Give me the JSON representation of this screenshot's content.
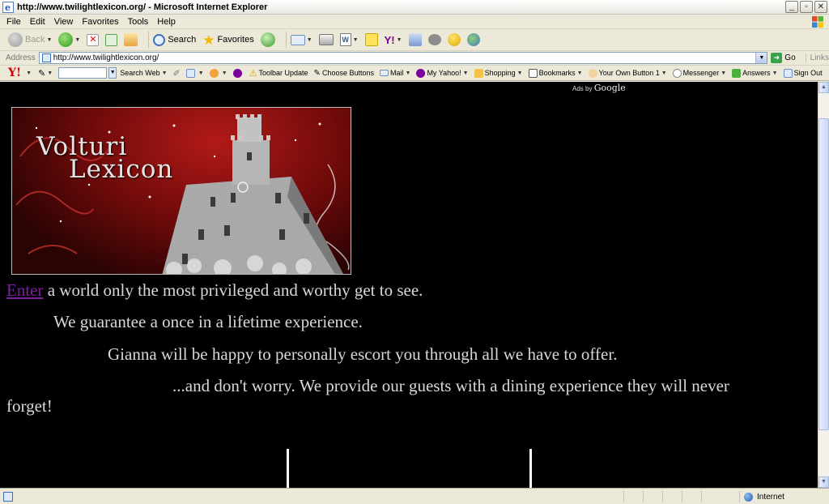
{
  "window": {
    "title": "http://www.twilightlexicon.org/ - Microsoft Internet Explorer",
    "minimize": "_",
    "maximize": "▫",
    "close": "✕"
  },
  "menu": [
    "File",
    "Edit",
    "View",
    "Favorites",
    "Tools",
    "Help"
  ],
  "toolbar": {
    "back": "Back",
    "search": "Search",
    "favorites": "Favorites"
  },
  "address": {
    "label": "Address",
    "url": "http://www.twilightlexicon.org/",
    "go": "Go",
    "links": "Links"
  },
  "yahoo_toolbar": {
    "logo": "Y!",
    "search_web": "Search Web",
    "items": [
      "Toolbar Update",
      "Choose Buttons",
      "Mail",
      "My Yahoo!",
      "Shopping",
      "Bookmarks",
      "Your Own Button 1",
      "Messenger",
      "Answers",
      "Sign Out"
    ]
  },
  "content": {
    "ads_by": "Ads by",
    "google": "Google",
    "banner_line1": "Volturi",
    "banner_line2": "Lexicon",
    "enter_link": "Enter",
    "line1_rest": " a world only the most privileged and worthy get to see.",
    "line2": "We guarantee a once in a lifetime experience.",
    "line3": "Gianna will be happy to personally escort you through all we have to offer.",
    "line4a": "...and don't worry. We provide our guests with a dining experience they will never",
    "line4b": "forget!"
  },
  "status": {
    "zone": "Internet"
  },
  "colors": {
    "link_visited": "#7a1fa0",
    "page_background": "#000000",
    "body_text": "#d8d8d8"
  }
}
